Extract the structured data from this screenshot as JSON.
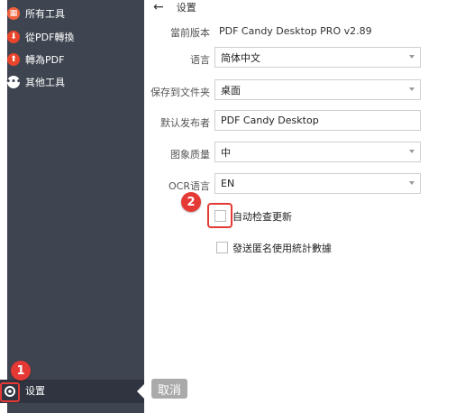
{
  "sidebar": {
    "items": [
      {
        "label": "所有工具",
        "icon": "grid-icon",
        "color": "#f0613a"
      },
      {
        "label": "從PDF轉換",
        "icon": "export-icon",
        "color": "#e9452c"
      },
      {
        "label": "轉為PDF",
        "icon": "import-icon",
        "color": "#e9452c"
      },
      {
        "label": "其他工具",
        "icon": "more-icon",
        "color": "#ffffff"
      }
    ],
    "settings_label": "设置"
  },
  "header": {
    "back_icon": "←",
    "title": "设置"
  },
  "settings": {
    "version_label": "當前版本",
    "version_value": "PDF Candy Desktop PRO v2.89",
    "language_label": "语言",
    "language_value": "简体中文",
    "save_folder_label": "保存到文件夹",
    "save_folder_value": "桌面",
    "publisher_label": "默认发布者",
    "publisher_value": "PDF Candy Desktop",
    "image_quality_label": "图象质量",
    "image_quality_value": "中",
    "ocr_label": "OCR语言",
    "ocr_value": "EN",
    "auto_update_label": "自动检查更新",
    "anon_stats_label": "發送匿名使用統計數據"
  },
  "tooltip": {
    "cancel_label": "取消"
  },
  "badges": {
    "one": "1",
    "two": "2"
  },
  "colors": {
    "sidebar_bg": "#3e4450",
    "accent": "#e53935"
  }
}
